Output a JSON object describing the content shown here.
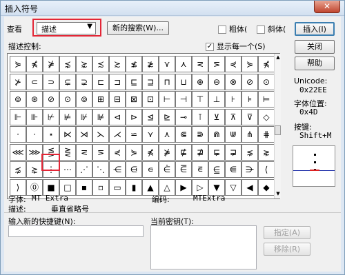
{
  "window": {
    "title": "插入符号",
    "close": "✕"
  },
  "view": {
    "label": "查看",
    "selected": "描述",
    "new_search": "新的搜索(W)..."
  },
  "checks": {
    "bold": "粗体(",
    "italic": "斜体("
  },
  "buttons": {
    "insert": "插入(I)",
    "close": "关闭",
    "help": "帮助",
    "assign": "指定(A)",
    "remove": "移除(R)"
  },
  "describe_ctrl": {
    "label": "描述控制:",
    "show_each": "显示每一个(S)",
    "show_each_checked": true
  },
  "symbols": [
    [
      "⋟",
      "⋠",
      "⋡",
      "⋨",
      "⋩",
      "≾",
      "≿",
      "≴",
      "≵",
      "⋎",
      "⋏",
      "⋜",
      "⋝",
      "⋞",
      "⋟",
      "⋠"
    ],
    [
      "⊁",
      "⊂",
      "⊃",
      "⊊",
      "⊋",
      "⊏",
      "⊐",
      "⊑",
      "⊒",
      "⊓",
      "⊔",
      "⊕",
      "⊖",
      "⊗",
      "⊘",
      "⊙"
    ],
    [
      "⊚",
      "⊛",
      "⊘",
      "⊙",
      "⊚",
      "⊞",
      "⊟",
      "⊠",
      "⊡",
      "⊢",
      "⊣",
      "⊤",
      "⊥",
      "⊦",
      "⊧",
      "⊨"
    ],
    [
      "⊩",
      "⊪",
      "⊬",
      "⊭",
      "⊮",
      "⊯",
      "⊲",
      "⊳",
      "⊴",
      "⊵",
      "⊸",
      "⊺",
      "⊻",
      "⊼",
      "⊽",
      "◇"
    ],
    [
      "·",
      "⋅",
      "⋆",
      "⋉",
      "⋊",
      "⋋",
      "⋌",
      "⋍",
      "⋎",
      "⋏",
      "⋐",
      "⋑",
      "⋒",
      "⋓",
      "⋔",
      "⋕"
    ],
    [
      "⋘",
      "⋙",
      "⋚",
      "⋛",
      "⋜",
      "⋝",
      "⋞",
      "⋟",
      "⋠",
      "⋡",
      "⋢",
      "⋣",
      "⋤",
      "⋥",
      "⋦",
      "⋧"
    ],
    [
      "⋨",
      "⋩",
      "⋮",
      "⋯",
      "⋰",
      "⋱",
      "⋲",
      "⋳",
      "⋴",
      "⋵",
      "⋶",
      "⋷",
      "⋸",
      "⋹",
      "⋺",
      "⟨"
    ],
    [
      "⟩",
      "⓪",
      "■",
      "□",
      "▪",
      "▫",
      "▭",
      "▮",
      "▲",
      "△",
      "▶",
      "▷",
      "▼",
      "▽",
      "◀",
      "◆"
    ]
  ],
  "info": {
    "unicode_label": "Unicode:",
    "unicode_value": "0x22EE",
    "font_pos_label": "字体位置:",
    "font_pos_value": "0x4D",
    "key_label": "按键:",
    "key_value": "Shift+M"
  },
  "font_line": {
    "font_label": "字体:",
    "font_value": "MT Extra",
    "code_label": "编码:",
    "code_value": "MTExtra"
  },
  "desc_line": {
    "label": "描述:",
    "value": "垂直省略号"
  },
  "shortcut": {
    "label": "输入新的快捷键(N):",
    "current_label": "当前密钥(T):",
    "value": ""
  }
}
